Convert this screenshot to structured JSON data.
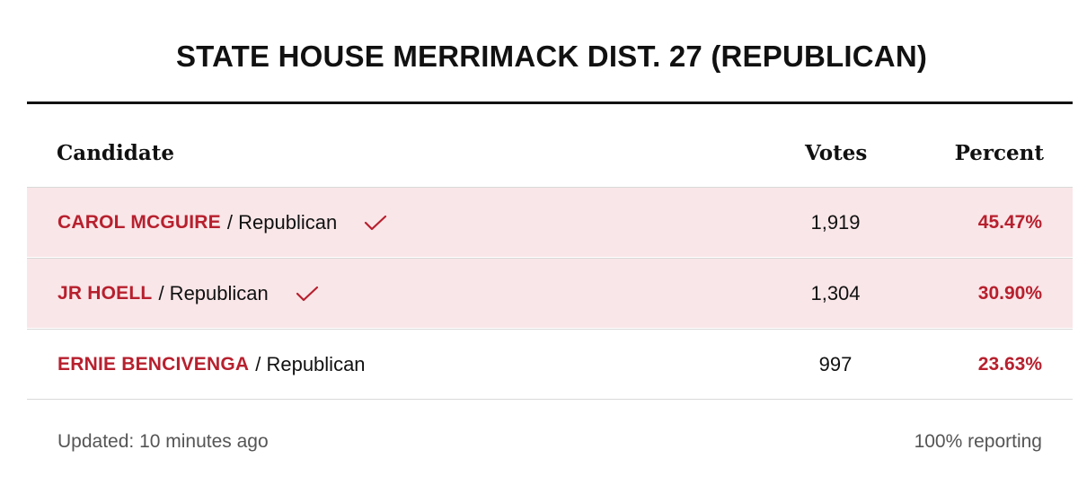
{
  "title": "STATE HOUSE MERRIMACK DIST. 27 (REPUBLICAN)",
  "columns": {
    "candidate": "Candidate",
    "votes": "Votes",
    "percent": "Percent"
  },
  "rows": [
    {
      "name": "CAROL MCGUIRE",
      "party": "/ Republican",
      "votes": "1,919",
      "percent": "45.47%",
      "winner": true,
      "icon": "checkmark-icon"
    },
    {
      "name": "JR HOELL",
      "party": "/ Republican",
      "votes": "1,304",
      "percent": "30.90%",
      "winner": true,
      "icon": "checkmark-icon"
    },
    {
      "name": "ERNIE BENCIVENGA",
      "party": "/ Republican",
      "votes": "997",
      "percent": "23.63%",
      "winner": false
    }
  ],
  "footer": {
    "updated": "Updated: 10 minutes ago",
    "reporting": "100% reporting"
  },
  "colors": {
    "accent": "#b7202e",
    "winner_row_bg": "#f9e6e8",
    "text": "#111111",
    "muted": "#555555"
  }
}
